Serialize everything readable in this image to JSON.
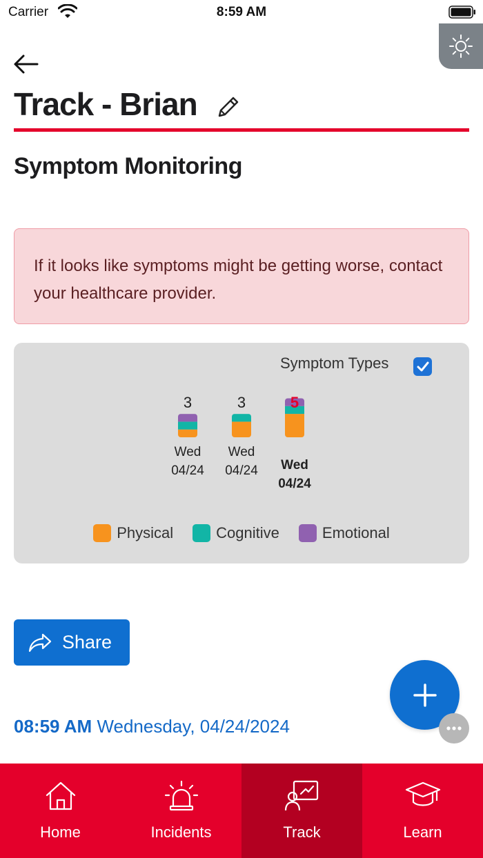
{
  "status_bar": {
    "carrier": "Carrier",
    "time": "8:59 AM"
  },
  "header": {
    "title": "Track - Brian"
  },
  "section": {
    "title": "Symptom Monitoring"
  },
  "warning": {
    "text": "If it looks like symptoms might be getting worse, contact your healthcare provider."
  },
  "chart": {
    "toggle_label": "Symptom Types",
    "toggle_checked": true
  },
  "chart_data": {
    "type": "bar",
    "stacked": true,
    "categories": [
      {
        "day": "Wed",
        "date": "04/24"
      },
      {
        "day": "Wed",
        "date": "04/24"
      },
      {
        "day": "Wed",
        "date": "04/24"
      }
    ],
    "totals": [
      3,
      3,
      5
    ],
    "highlighted_index": 2,
    "series": [
      {
        "name": "Physical",
        "color": "#f7931e",
        "values": [
          1,
          2,
          3
        ]
      },
      {
        "name": "Cognitive",
        "color": "#12b5a6",
        "values": [
          1,
          1,
          1
        ]
      },
      {
        "name": "Emotional",
        "color": "#9061b0",
        "values": [
          1,
          0,
          1
        ]
      }
    ],
    "highlight_color": "#e4002b"
  },
  "share": {
    "label": "Share"
  },
  "entry": {
    "time": "08:59 AM",
    "date": "Wednesday, 04/24/2024"
  },
  "tabs": [
    {
      "label": "Home",
      "icon": "home-icon",
      "active": false
    },
    {
      "label": "Incidents",
      "icon": "alarm-icon",
      "active": false
    },
    {
      "label": "Track",
      "icon": "track-chart-icon",
      "active": true
    },
    {
      "label": "Learn",
      "icon": "graduation-cap-icon",
      "active": false
    }
  ],
  "colors": {
    "brand_red": "#e4002b",
    "primary_blue": "#0f6fd0"
  }
}
